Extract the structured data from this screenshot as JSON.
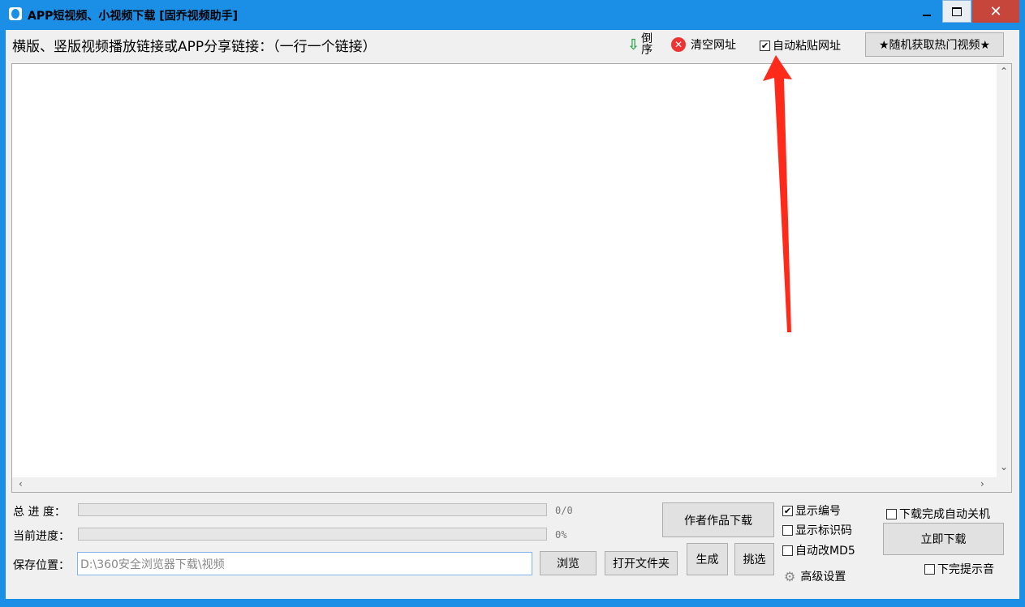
{
  "window": {
    "title": "APP短视频、小视频下载 [固乔视频助手]",
    "minimize_icon": "minimize-icon",
    "maximize_icon": "maximize-icon",
    "close_symbol": "✕"
  },
  "toolbar": {
    "links_label": "横版、竖版视频播放链接或APP分享链接：（一行一个链接）",
    "reverse_label": "倒序",
    "reverse_arrow": "⇩",
    "clear_label": "清空网址",
    "auto_paste_label": "自动粘贴网址",
    "auto_paste_checked": true,
    "hot_videos_label": "★随机获取热门视频★"
  },
  "links_input": {
    "value": ""
  },
  "scroll": {
    "up": "⌃",
    "down": "⌄",
    "left": "‹",
    "right": "›"
  },
  "progress": {
    "total_label": "总 进 度：",
    "total_text": "0/0",
    "total_fraction": 0,
    "current_label": "当前进度：",
    "current_text": "0%",
    "current_fraction": 0
  },
  "save": {
    "label": "保存位置：",
    "path": "D:\\360安全浏览器下载\\视频",
    "browse_label": "浏览",
    "open_folder_label": "打开文件夹"
  },
  "actions": {
    "author_download_label": "作者作品下载",
    "generate_label": "生成",
    "select_label": "挑选",
    "download_now_label": "立即下载"
  },
  "options": {
    "show_number": {
      "label": "显示编号",
      "checked": true
    },
    "show_id_code": {
      "label": "显示标识码",
      "checked": false
    },
    "auto_md5": {
      "label": "自动改MD5",
      "checked": false
    },
    "advanced_label": "高级设置",
    "auto_shutdown": {
      "label": "下载完成自动关机",
      "checked": false
    },
    "done_sound": {
      "label": "下完提示音",
      "checked": false
    }
  },
  "colors": {
    "titlebar": "#1b8ee6",
    "close": "#c7463b",
    "annotation_arrow": "#ff2a1a"
  }
}
